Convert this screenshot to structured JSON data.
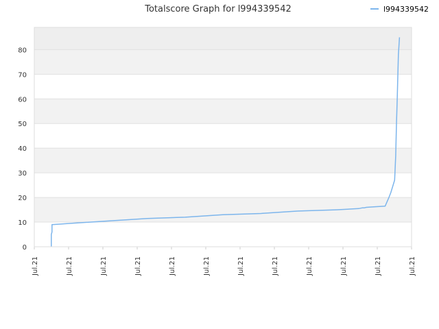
{
  "chart_data": {
    "type": "line",
    "title": "Totalscore Graph for l994339542",
    "xlabel": "",
    "ylabel": "",
    "ylim": [
      0,
      89
    ],
    "y_ticks": [
      0,
      10,
      20,
      30,
      40,
      50,
      60,
      70,
      80
    ],
    "x_tick_labels": [
      "Jul.21",
      "Jul.21",
      "Jul.21",
      "Jul.21",
      "Jul.21",
      "Jul.21",
      "Jul.21",
      "Jul.21",
      "Jul.21",
      "Jul.21",
      "Jul.21",
      "Jul.21"
    ],
    "grid": true,
    "legend_position": "top-right",
    "series": [
      {
        "name": "l994339542",
        "color": "#7cb5ec",
        "x": [
          0.045,
          0.045,
          0.047,
          0.047,
          0.05,
          0.1,
          0.2,
          0.3,
          0.4,
          0.5,
          0.6,
          0.7,
          0.8,
          0.86,
          0.87,
          0.875,
          0.88,
          0.9,
          0.93,
          0.94,
          0.945,
          0.955,
          0.958,
          0.96,
          0.962,
          0.965,
          0.968
        ],
        "values": [
          0,
          5,
          6,
          9,
          9,
          9.5,
          10.5,
          11.5,
          12,
          13,
          13.5,
          14.5,
          15,
          15.5,
          15.8,
          15.8,
          16,
          16.2,
          16.5,
          20,
          22,
          27,
          37,
          50,
          60,
          78,
          85
        ]
      }
    ]
  },
  "colors": {
    "plot_band_dark": "#eeeeee",
    "plot_band_light": "#f2f2f2",
    "gridline": "#e0e0e0"
  }
}
